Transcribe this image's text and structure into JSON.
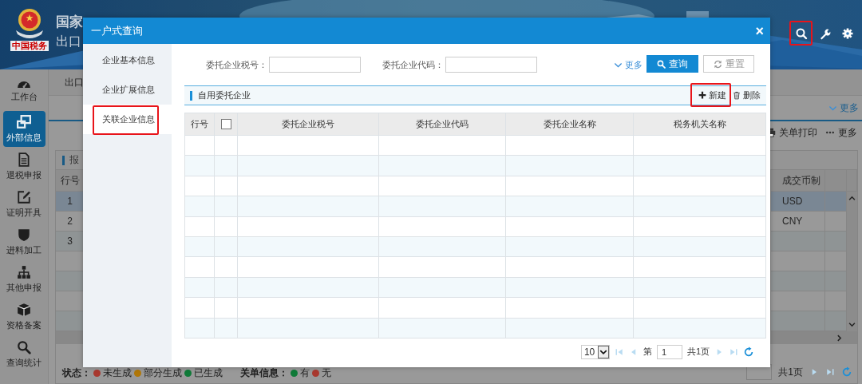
{
  "header": {
    "logo_text": "中国税务",
    "title": "国家",
    "subtitle": "出口",
    "tools": [
      {
        "kind": "search",
        "highlighted": true
      },
      {
        "kind": "wrench",
        "highlighted": false
      },
      {
        "kind": "gear",
        "highlighted": false
      }
    ]
  },
  "sidebar": {
    "items": [
      {
        "label": "工作台",
        "selected": false
      },
      {
        "label": "外部信息",
        "selected": true
      },
      {
        "label": "退税申报",
        "selected": false
      },
      {
        "label": "证明开具",
        "selected": false
      },
      {
        "label": "进料加工",
        "selected": false
      },
      {
        "label": "其他申报",
        "selected": false
      },
      {
        "label": "资格备案",
        "selected": false
      },
      {
        "label": "查询统计",
        "selected": false
      }
    ]
  },
  "page": {
    "tab": "出口",
    "more": "更多",
    "toolbar": [
      {
        "kind": "print",
        "label": "关单打印"
      },
      {
        "kind": "more",
        "label": "更多"
      }
    ],
    "panel_title": "报",
    "table": {
      "columns": [
        "行号",
        "成交币制"
      ],
      "rows": [
        {
          "number": "1",
          "currency": "USD",
          "selected": true
        },
        {
          "number": "2",
          "currency": "CNY",
          "selected": false
        },
        {
          "number": "3",
          "selected": false
        }
      ]
    },
    "legend": [
      {
        "title": "状态：",
        "items": [
          {
            "label": "未生成",
            "color": "#a8382e"
          },
          {
            "label": "部分生成",
            "color": "#b07708"
          },
          {
            "label": "已生成",
            "color": "#0f7a38"
          }
        ]
      },
      {
        "title": "关单信息：",
        "items": [
          {
            "label": "有",
            "color": "#0f7a38"
          },
          {
            "label": "无",
            "color": "#a8382e"
          }
        ]
      }
    ],
    "pager": {
      "total": "共1页",
      "buttons": [
        {
          "kind": "next",
          "disabled": true
        },
        {
          "kind": "last",
          "disabled": true
        }
      ]
    }
  },
  "dialog": {
    "title": "一户式查询",
    "close": "×",
    "nav": [
      {
        "label": "企业基本信息",
        "selected": false,
        "highlighted": false
      },
      {
        "label": "企业扩展信息",
        "selected": false,
        "highlighted": false
      },
      {
        "label": "关联企业信息",
        "selected": true,
        "highlighted": true
      }
    ],
    "filters": [
      {
        "label": "委托企业税号："
      },
      {
        "label": "委托企业代码："
      }
    ],
    "more": "更多",
    "buttons": [
      {
        "kind": "primary",
        "label": "查询"
      },
      {
        "kind": "reset",
        "label": "重置"
      }
    ],
    "section": {
      "title": "自用委托企业",
      "actions": [
        {
          "kind": "add",
          "label": "新建",
          "highlighted": true
        },
        {
          "kind": "delete",
          "label": "删除",
          "highlighted": false
        }
      ]
    },
    "table": {
      "columns": [
        {
          "kind": "text",
          "label": "行号"
        },
        {
          "kind": "checkbox",
          "checked": false
        },
        {
          "kind": "text",
          "label": "委托企业税号"
        },
        {
          "kind": "text",
          "label": "委托企业代码"
        },
        {
          "kind": "text",
          "label": "委托企业名称"
        },
        {
          "kind": "text",
          "label": "税务机关名称"
        }
      ]
    },
    "pager": {
      "page_size": "10",
      "page_label": "第",
      "page": "1",
      "total": "共1页",
      "buttons": [
        {
          "kind": "first",
          "disabled": true
        },
        {
          "kind": "prev",
          "disabled": true
        },
        {
          "kind": "next",
          "disabled": true
        },
        {
          "kind": "last",
          "disabled": true
        }
      ]
    }
  }
}
